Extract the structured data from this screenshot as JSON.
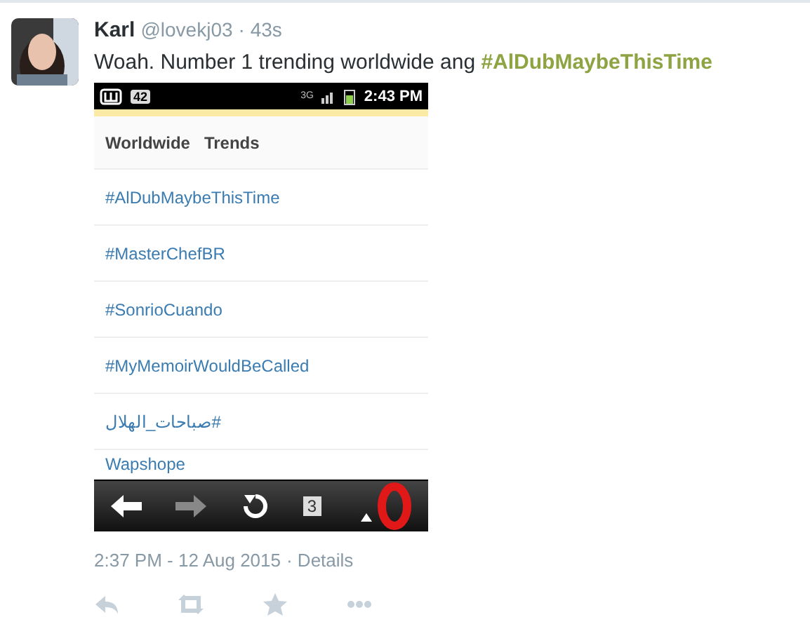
{
  "tweet": {
    "name": "Karl",
    "handle": "@lovekj03",
    "age": "· 43s",
    "text": "Woah. Number 1 trending worldwide ang ",
    "hashtag": "#AlDubMaybeThisTime",
    "phone": {
      "app_badge": "42",
      "network": "3G",
      "time": "2:43 PM",
      "heading": "Worldwide   Trends",
      "trends": [
        "#AlDubMaybeThisTime",
        "#MasterChefBR",
        "#SonrioCuando",
        "#MyMemoirWouldBeCalled",
        "صباحات_الهلال#",
        "Wapshope"
      ],
      "tab_count": "3"
    },
    "timestamp": "2:37 PM - 12 Aug 2015",
    "details": "· Details"
  }
}
